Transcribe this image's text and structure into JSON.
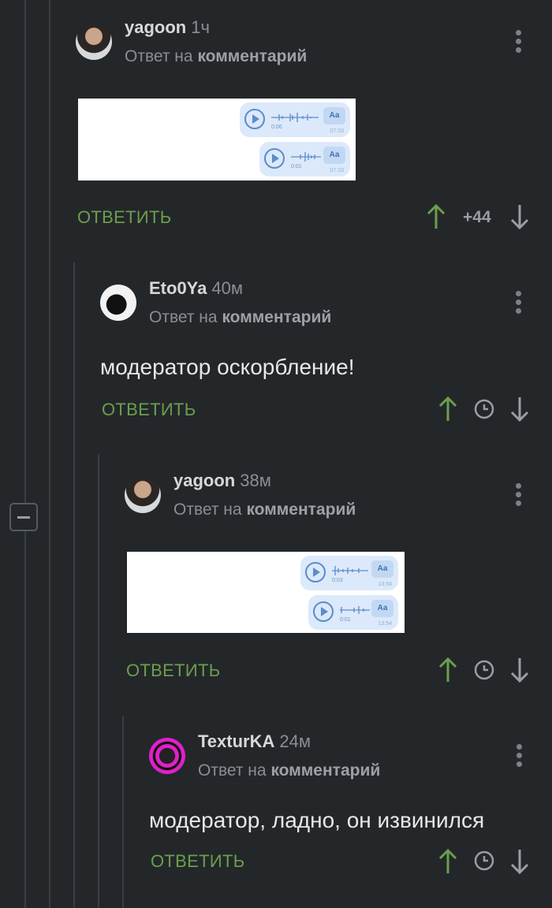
{
  "comments": [
    {
      "author": "yagoon",
      "time": "1ч",
      "reply_prefix": "Ответ на",
      "reply_target": "комментарий",
      "reply_label": "ОТВЕТИТЬ",
      "score": "+44",
      "attachment": {
        "messages": [
          {
            "duration": "0:06",
            "clock": "07:33"
          },
          {
            "duration": "0:01",
            "clock": "07:33"
          }
        ],
        "button_label": "Aa"
      }
    },
    {
      "author": "Eto0Ya",
      "time": "40м",
      "reply_prefix": "Ответ на",
      "reply_target": "комментарий",
      "text": "модератор оскорбление!",
      "reply_label": "ОТВЕТИТЬ"
    },
    {
      "author": "yagoon",
      "time": "38м",
      "reply_prefix": "Ответ на",
      "reply_target": "комментарий",
      "reply_label": "ОТВЕТИТЬ",
      "attachment": {
        "messages": [
          {
            "duration": "0:03",
            "clock": "13:54"
          },
          {
            "duration": "0:01",
            "clock": "13:54"
          }
        ],
        "button_label": "Aa"
      }
    },
    {
      "author": "TexturKA",
      "time": "24м",
      "reply_prefix": "Ответ на",
      "reply_target": "комментарий",
      "text": "модератор, ладно, он извинился",
      "reply_label": "ОТВЕТИТЬ"
    }
  ],
  "icons": {
    "upvote": "arrow-up-icon",
    "downvote": "arrow-down-icon",
    "pending": "clock-icon",
    "menu": "more-vertical-icon",
    "collapse": "minus-square-icon"
  },
  "colors": {
    "background": "#24272a",
    "accent_green": "#6a9f4d",
    "muted": "#8a8e92"
  }
}
